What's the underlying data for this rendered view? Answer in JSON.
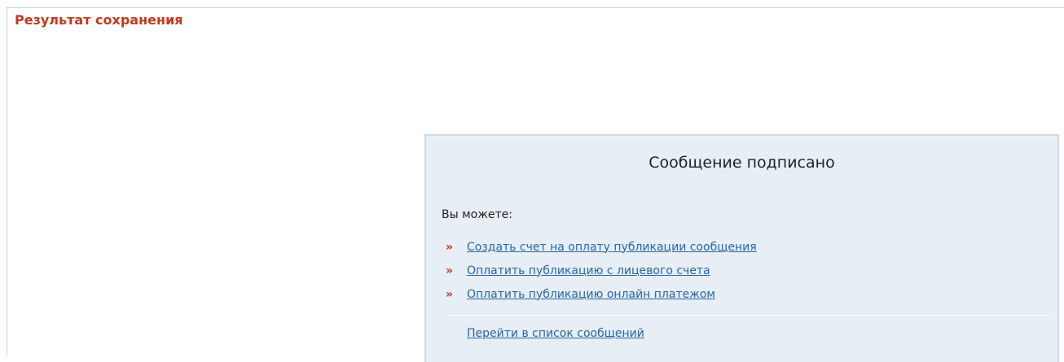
{
  "page": {
    "title": "Результат сохранения"
  },
  "panel": {
    "title": "Сообщение подписано",
    "lead": "Вы можете:",
    "actions": [
      {
        "label": "Создать счет на оплату публикации сообщения",
        "bullet": "»"
      },
      {
        "label": "Оплатить публикацию с лицевого счета",
        "bullet": "»"
      },
      {
        "label": "Оплатить публикацию онлайн платежом",
        "bullet": "»"
      }
    ],
    "secondary_link": "Перейти в список сообщений"
  },
  "colors": {
    "title_red": "#c0391f",
    "link_blue": "#2467a7",
    "panel_bg": "#e8eef6",
    "panel_border": "#cfd9e6"
  },
  "icons": {
    "action_bullet": "double-chevron-right-icon"
  }
}
